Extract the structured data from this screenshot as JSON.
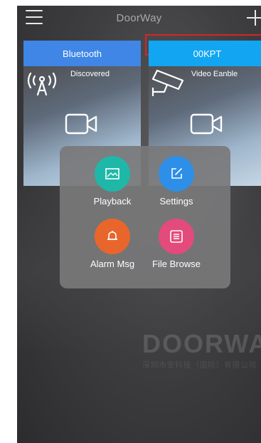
{
  "header": {
    "title": "DoorWay",
    "menu_icon": "hamburger-icon",
    "add_icon": "plus-icon"
  },
  "devices": [
    {
      "name": "Bluetooth",
      "status": "Discovered",
      "overlay_icon": "antenna-icon",
      "camera_icon": "video-camera-icon",
      "header_color": "#3f86e6"
    },
    {
      "name": "00KPT",
      "status": "Video Eanble",
      "overlay_icon": "cctv-camera-icon",
      "camera_icon": "video-camera-icon",
      "header_color": "#12a6f2"
    }
  ],
  "popup": {
    "actions": [
      {
        "label": "Playback",
        "icon": "image-icon",
        "color": "#1fb8a8"
      },
      {
        "label": "Settings",
        "icon": "edit-icon",
        "color": "#2d8fe8"
      },
      {
        "label": "Alarm Msg",
        "icon": "bell-icon",
        "color": "#e8662c"
      },
      {
        "label": "File Browse",
        "icon": "list-icon",
        "color": "#e24b7c"
      }
    ]
  },
  "watermark": {
    "brand": "DOORWAY",
    "subtitle": "深圳市安科技（国际）有限公司"
  }
}
